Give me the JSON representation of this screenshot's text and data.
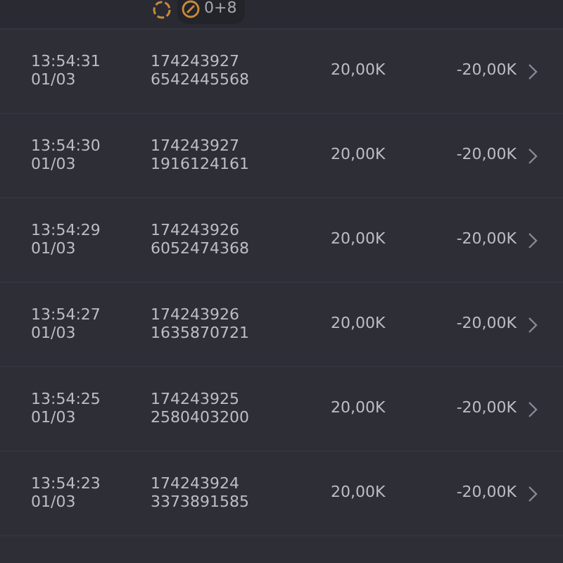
{
  "top_row": {
    "badge": "0+8"
  },
  "rows": [
    {
      "time": "13:54:31",
      "date": "01/03",
      "id_line1": "174243927",
      "id_line2": "6542445568",
      "amount": "20,00K",
      "result": "-20,00K"
    },
    {
      "time": "13:54:30",
      "date": "01/03",
      "id_line1": "174243927",
      "id_line2": "1916124161",
      "amount": "20,00K",
      "result": "-20,00K"
    },
    {
      "time": "13:54:29",
      "date": "01/03",
      "id_line1": "174243926",
      "id_line2": "6052474368",
      "amount": "20,00K",
      "result": "-20,00K"
    },
    {
      "time": "13:54:27",
      "date": "01/03",
      "id_line1": "174243926",
      "id_line2": "1635870721",
      "amount": "20,00K",
      "result": "-20,00K"
    },
    {
      "time": "13:54:25",
      "date": "01/03",
      "id_line1": "174243925",
      "id_line2": "2580403200",
      "amount": "20,00K",
      "result": "-20,00K"
    },
    {
      "time": "13:54:23",
      "date": "01/03",
      "id_line1": "174243924",
      "id_line2": "3373891585",
      "amount": "20,00K",
      "result": "-20,00K"
    }
  ]
}
